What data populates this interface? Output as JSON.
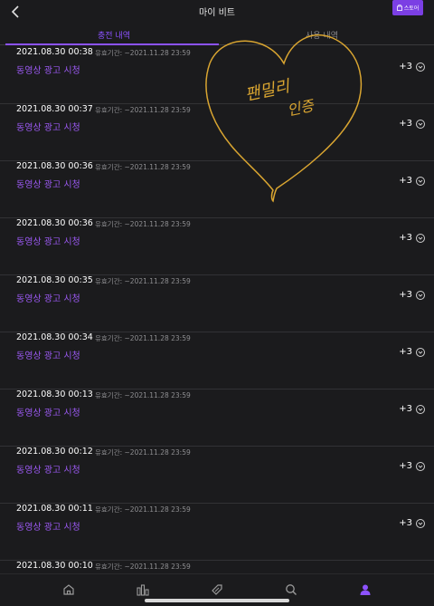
{
  "header": {
    "title": "마이 비트",
    "store_label": "스토어"
  },
  "tabs": [
    {
      "label": "충전 내역",
      "active": true
    },
    {
      "label": "사용 내역",
      "active": false
    }
  ],
  "rows": [
    {
      "date": "2021.08.30 00:38",
      "expiry": "유효기간: ~2021.11.28 23:59",
      "desc": "동영상 광고 시청",
      "amount": "+3"
    },
    {
      "date": "2021.08.30 00:37",
      "expiry": "유효기간: ~2021.11.28 23:59",
      "desc": "동영상 광고 시청",
      "amount": "+3"
    },
    {
      "date": "2021.08.30 00:36",
      "expiry": "유효기간: ~2021.11.28 23:59",
      "desc": "동영상 광고 시청",
      "amount": "+3"
    },
    {
      "date": "2021.08.30 00:36",
      "expiry": "유효기간: ~2021.11.28 23:59",
      "desc": "동영상 광고 시청",
      "amount": "+3"
    },
    {
      "date": "2021.08.30 00:35",
      "expiry": "유효기간: ~2021.11.28 23:59",
      "desc": "동영상 광고 시청",
      "amount": "+3"
    },
    {
      "date": "2021.08.30 00:34",
      "expiry": "유효기간: ~2021.11.28 23:59",
      "desc": "동영상 광고 시청",
      "amount": "+3"
    },
    {
      "date": "2021.08.30 00:13",
      "expiry": "유효기간: ~2021.11.28 23:59",
      "desc": "동영상 광고 시청",
      "amount": "+3"
    },
    {
      "date": "2021.08.30 00:12",
      "expiry": "유효기간: ~2021.11.28 23:59",
      "desc": "동영상 광고 시청",
      "amount": "+3"
    },
    {
      "date": "2021.08.30 00:11",
      "expiry": "유효기간: ~2021.11.28 23:59",
      "desc": "동영상 광고 시청",
      "amount": "+3"
    },
    {
      "date": "2021.08.30 00:10",
      "expiry": "유효기간: ~2021.11.28 23:59",
      "desc": "",
      "amount": ""
    }
  ],
  "handwriting": {
    "line1": "팬밀리",
    "line2": "인증",
    "color": "#d9a531"
  },
  "bottom_nav": [
    {
      "icon": "home-icon",
      "active": false
    },
    {
      "icon": "chart-icon",
      "active": false
    },
    {
      "icon": "tag-icon",
      "active": false
    },
    {
      "icon": "search-icon",
      "active": false
    },
    {
      "icon": "profile-icon",
      "active": true
    }
  ],
  "colors": {
    "accent": "#8c52ff",
    "description": "#9b59f2",
    "background": "#1b1b1d"
  }
}
